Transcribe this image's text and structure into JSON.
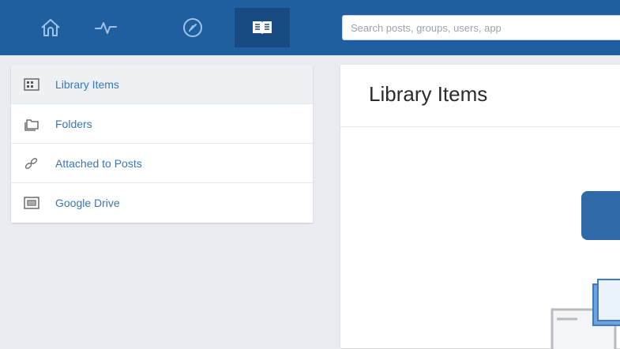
{
  "topbar": {
    "nav": [
      {
        "name": "home-icon"
      },
      {
        "name": "activity-icon"
      },
      {
        "name": "compass-icon"
      },
      {
        "name": "library-book-icon"
      }
    ],
    "search": {
      "placeholder": "Search posts, groups, users, app"
    }
  },
  "sidebar": {
    "items": [
      {
        "label": "Library Items",
        "icon": "grid-icon"
      },
      {
        "label": "Folders",
        "icon": "folders-icon"
      },
      {
        "label": "Attached to Posts",
        "icon": "link-icon"
      },
      {
        "label": "Google Drive",
        "icon": "drive-icon"
      }
    ]
  },
  "main": {
    "title": "Library Items"
  },
  "colors": {
    "brand": "#1f5fa0",
    "brand_active": "#164a80",
    "link": "#3a76b8",
    "background": "#e8ecf0"
  }
}
